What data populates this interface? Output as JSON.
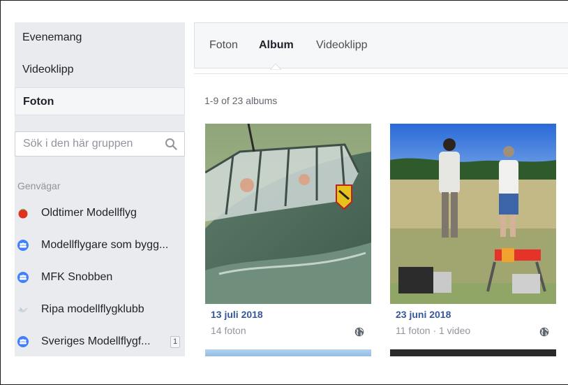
{
  "sidebar": {
    "nav": [
      {
        "label": "Evenemang"
      },
      {
        "label": "Videoklipp"
      },
      {
        "label": "Foton"
      }
    ],
    "search_placeholder": "Sök i den här gruppen",
    "shortcuts_heading": "Genvägar",
    "shortcuts": [
      {
        "label": "Oldtimer Modellflyg",
        "icon": "tomato-icon"
      },
      {
        "label": "Modellflygare som bygg...",
        "icon": "group-icon"
      },
      {
        "label": "MFK Snobben",
        "icon": "group-icon"
      },
      {
        "label": "Ripa modellflygklubb",
        "icon": "bird-icon"
      },
      {
        "label": "Sveriges Modellflygf...",
        "icon": "group-icon",
        "badge": "1"
      }
    ]
  },
  "tabs": [
    {
      "label": "Foton"
    },
    {
      "label": "Album"
    },
    {
      "label": "Videoklipp"
    }
  ],
  "count_text": "1-9 of 23 albums",
  "albums": [
    {
      "title": "13 juli 2018",
      "meta": "14 foton",
      "privacy_icon": "globe-icon"
    },
    {
      "title": "23 juni 2018",
      "meta": "11 foton · 1 video",
      "privacy_icon": "globe-icon"
    }
  ],
  "colors": {
    "link": "#365899",
    "sidebar_bg": "#e9ebee",
    "group_icon": "#4080ff"
  }
}
